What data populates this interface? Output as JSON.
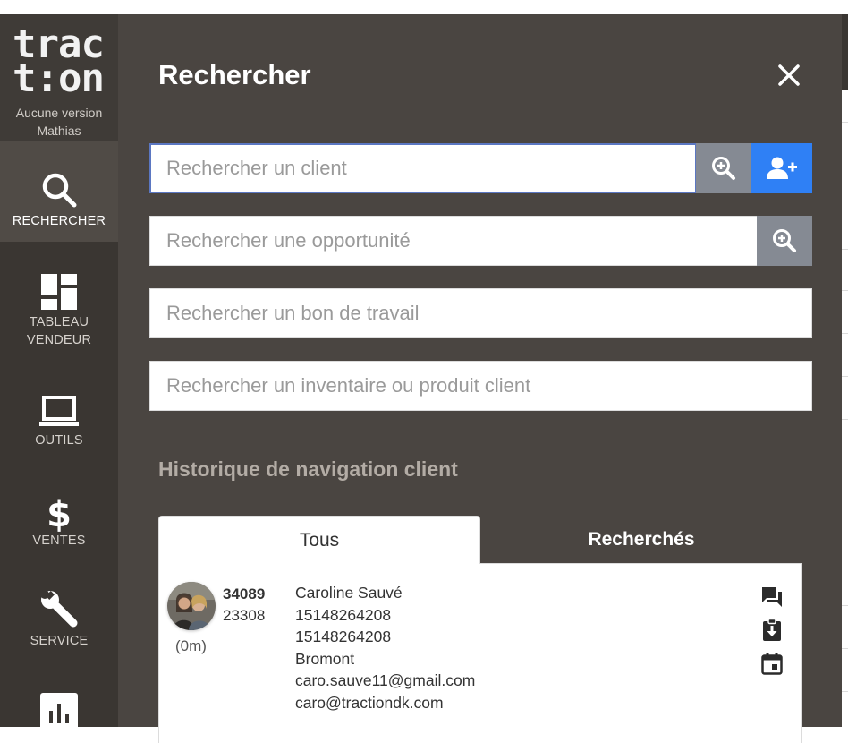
{
  "brand": {
    "logo_line1": "trac",
    "logo_line2": "t:on",
    "version": "Aucune version",
    "user": "Mathias"
  },
  "sidebar": {
    "items": [
      {
        "label": "RECHERCHER",
        "icon": "search-icon",
        "active": true
      },
      {
        "label": "TABLEAU VENDEUR",
        "icon": "dashboard-icon",
        "active": false
      },
      {
        "label": "OUTILS",
        "icon": "laptop-icon",
        "active": false
      },
      {
        "label": "VENTES",
        "icon": "dollar-icon",
        "active": false
      },
      {
        "label": "SERVICE",
        "icon": "wrench-icon",
        "active": false
      },
      {
        "label": "",
        "icon": "bar-chart-icon",
        "active": false
      }
    ]
  },
  "panel": {
    "title": "Rechercher",
    "search_client_placeholder": "Rechercher un client",
    "search_opportunity_placeholder": "Rechercher une opportunité",
    "search_workorder_placeholder": "Rechercher un bon de travail",
    "search_inventory_placeholder": "Rechercher un inventaire ou produit client",
    "history_title": "Historique de navigation client",
    "tabs": [
      {
        "label": "Tous",
        "active": true
      },
      {
        "label": "Recherchés",
        "active": false
      }
    ]
  },
  "history": [
    {
      "id": "34089",
      "sub_id": "23308",
      "elapsed": "(0m)",
      "name": "Caroline Sauvé",
      "phone1": "15148264208",
      "phone2": "15148264208",
      "city": "Bromont",
      "email1": "caro.sauve11@gmail.com",
      "email2": "caro@tractiondk.com"
    }
  ],
  "colors": {
    "sidebar_bg": "#3a3632",
    "panel_bg": "#4a4541",
    "accent_blue": "#2f80f5",
    "button_gray": "#858a93"
  }
}
